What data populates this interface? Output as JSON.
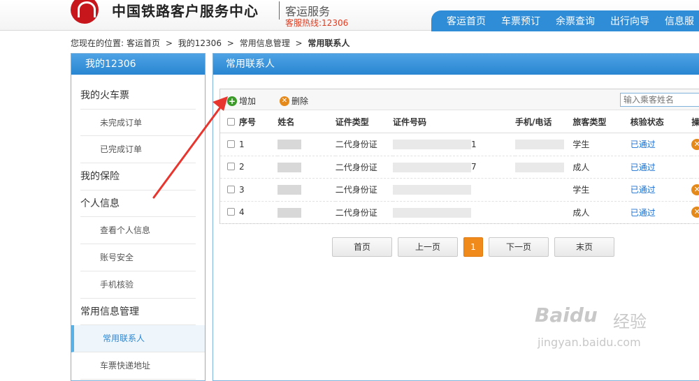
{
  "header": {
    "logo_text": "中国铁路客户服务中心",
    "sub_brand": "客运服务",
    "hotline": "客服热线:12306",
    "nav": [
      "客运首页",
      "车票预订",
      "余票查询",
      "出行向导",
      "信息服"
    ]
  },
  "breadcrumb": {
    "prefix": "您现在的位置:",
    "items": [
      "客运首页",
      ">",
      "我的12306",
      ">",
      "常用信息管理",
      ">"
    ],
    "current": "常用联系人"
  },
  "sidebar": {
    "title": "我的12306",
    "items": [
      {
        "label": "我的火车票",
        "level": 1
      },
      {
        "label": "未完成订单",
        "level": 2
      },
      {
        "label": "已完成订单",
        "level": 2
      },
      {
        "label": "我的保险",
        "level": 1
      },
      {
        "label": "个人信息",
        "level": 1
      },
      {
        "label": "查看个人信息",
        "level": 2
      },
      {
        "label": "账号安全",
        "level": 2
      },
      {
        "label": "手机核验",
        "level": 2
      },
      {
        "label": "常用信息管理",
        "level": 1
      },
      {
        "label": "常用联系人",
        "level": 2,
        "active": true
      },
      {
        "label": "车票快递地址",
        "level": 2
      }
    ]
  },
  "panel": {
    "title": "常用联系人",
    "add_label": "增加",
    "delete_label": "删除",
    "search_placeholder": "输入乘客姓名"
  },
  "table": {
    "columns": [
      "序号",
      "姓名",
      "证件类型",
      "证件号码",
      "手机/电话",
      "旅客类型",
      "核验状态",
      "操"
    ],
    "rows": [
      {
        "index": "1",
        "id_type": "二代身份证",
        "id_tail": "1",
        "passenger_type": "学生",
        "status": "已通过",
        "deletable": true
      },
      {
        "index": "2",
        "id_type": "二代身份证",
        "id_tail": "7",
        "passenger_type": "成人",
        "status": "已通过",
        "deletable": false
      },
      {
        "index": "3",
        "id_type": "二代身份证",
        "id_tail": "",
        "passenger_type": "学生",
        "status": "已通过",
        "deletable": true
      },
      {
        "index": "4",
        "id_type": "二代身份证",
        "id_tail": "",
        "passenger_type": "成人",
        "status": "已通过",
        "deletable": true
      }
    ]
  },
  "pager": {
    "first": "首页",
    "prev": "上一页",
    "current": "1",
    "next": "下一页",
    "last": "末页"
  },
  "watermark": {
    "brand": "Baidu",
    "cn": "经验",
    "url": "jingyan.baidu.com"
  },
  "colors": {
    "accent_blue": "#2f8dd8",
    "hotline_red": "#e03b1f",
    "pager_orange": "#f08a1a",
    "arrow_red": "#e8352e"
  }
}
